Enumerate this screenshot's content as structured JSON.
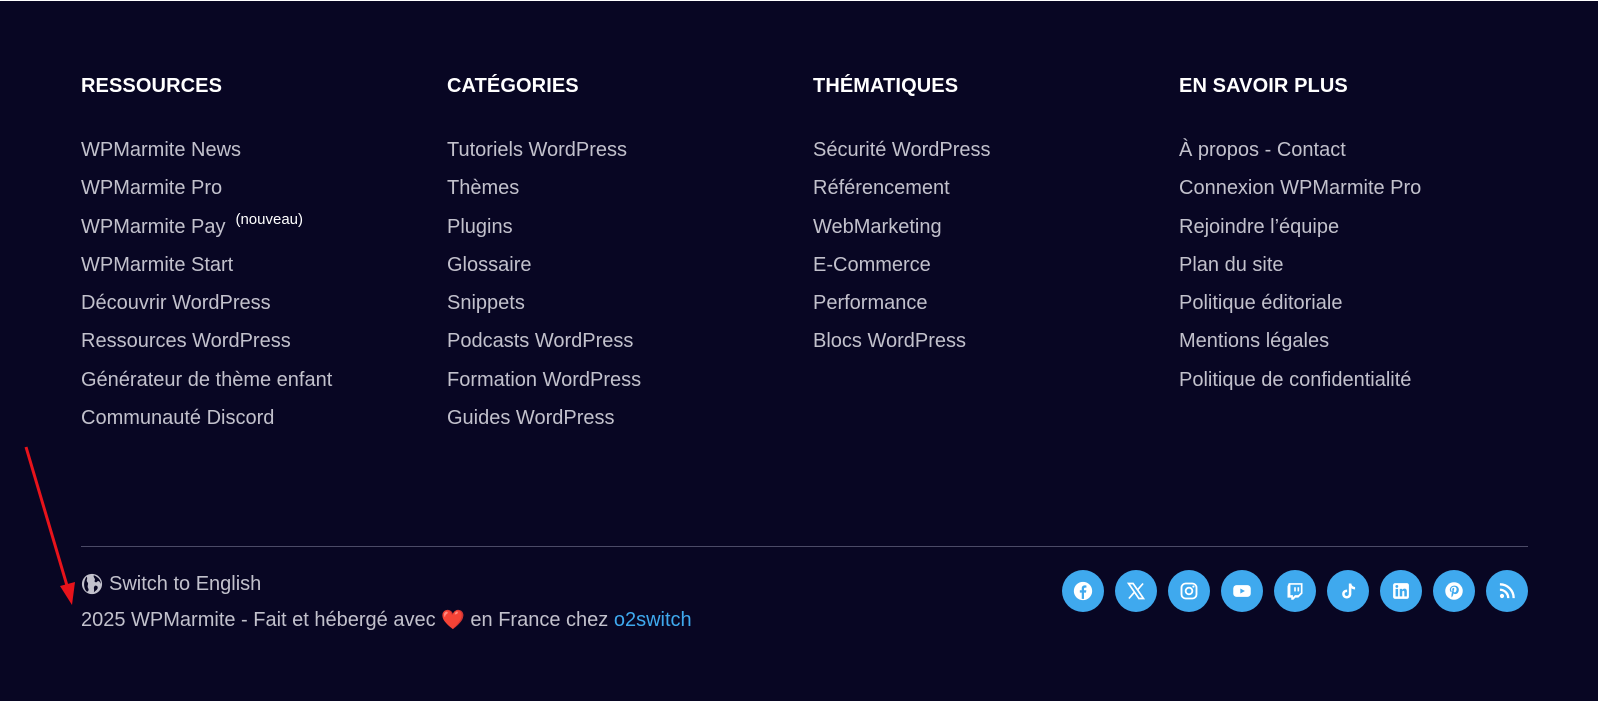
{
  "columns": [
    {
      "title": "RESSOURCES",
      "links": [
        "WPMarmite News",
        "WPMarmite Pro",
        "WPMarmite Pay",
        "WPMarmite Start",
        "Découvrir WordPress",
        "Ressources WordPress",
        "Générateur de thème enfant",
        "Communauté Discord"
      ],
      "badge": "(nouveau)"
    },
    {
      "title": "CATÉGORIES",
      "links": [
        "Tutoriels WordPress",
        "Thèmes",
        "Plugins",
        "Glossaire",
        "Snippets",
        "Podcasts WordPress",
        "Formation WordPress",
        "Guides WordPress"
      ]
    },
    {
      "title": "THÉMATIQUES",
      "links": [
        "Sécurité WordPress",
        "Référencement",
        "WebMarketing",
        "E-Commerce",
        "Performance",
        "Blocs WordPress"
      ]
    },
    {
      "title": "EN SAVOIR PLUS",
      "links": [
        "À propos - Contact",
        "Connexion WPMarmite Pro",
        "Rejoindre l’équipe",
        "Plan du site",
        "Politique éditoriale",
        "Mentions légales",
        "Politique de confidentialité"
      ]
    }
  ],
  "language_switch": {
    "label": "Switch to English",
    "icon": "globe-icon"
  },
  "copyright": {
    "prefix": "2025 WPMarmite - Fait et hébergé avec",
    "heart": "❤️",
    "middle": "en France chez",
    "host_link": "o2switch"
  },
  "socials": [
    "facebook-icon",
    "x-icon",
    "instagram-icon",
    "youtube-icon",
    "twitch-icon",
    "tiktok-icon",
    "linkedin-icon",
    "pinterest-icon",
    "rss-icon"
  ],
  "colors": {
    "background": "#080623",
    "link_text": "#c2c1cc",
    "heading": "#ffffff",
    "accent": "#3fa9ee",
    "annotation_arrow": "#e8131b"
  }
}
